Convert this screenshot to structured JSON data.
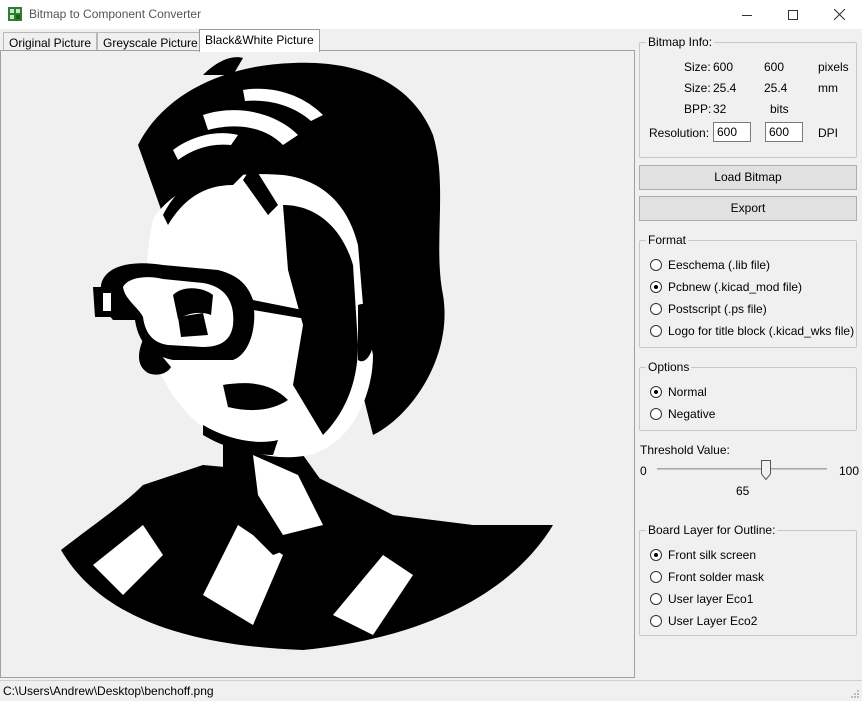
{
  "window": {
    "title": "Bitmap to Component Converter",
    "minimize_icon": "minimize-icon",
    "maximize_icon": "maximize-icon",
    "close_icon": "close-icon"
  },
  "tabs": [
    {
      "label": "Original Picture",
      "active": false
    },
    {
      "label": "Greyscale Picture",
      "active": false
    },
    {
      "label": "Black&White Picture",
      "active": true
    }
  ],
  "bitmap_info": {
    "title": "Bitmap Info:",
    "size_label": "Size:",
    "size_px_w": "600",
    "size_px_h": "600",
    "size_px_unit": "pixels",
    "size_mm_label": "Size:",
    "size_mm_w": "25.4",
    "size_mm_h": "25.4",
    "size_mm_unit": "mm",
    "bpp_label": "BPP:",
    "bpp_value": "32",
    "bpp_unit": "bits",
    "resolution_label": "Resolution:",
    "resolution_x": "600",
    "resolution_y": "600",
    "resolution_unit": "DPI"
  },
  "buttons": {
    "load": "Load Bitmap",
    "export": "Export"
  },
  "format": {
    "title": "Format",
    "options": [
      {
        "label": "Eeschema (.lib file)",
        "checked": false
      },
      {
        "label": "Pcbnew (.kicad_mod file)",
        "checked": true
      },
      {
        "label": "Postscript (.ps file)",
        "checked": false
      },
      {
        "label": "Logo for title block (.kicad_wks file)",
        "checked": false
      }
    ]
  },
  "options": {
    "title": "Options",
    "items": [
      {
        "label": "Normal",
        "checked": true
      },
      {
        "label": "Negative",
        "checked": false
      }
    ]
  },
  "threshold": {
    "label": "Threshold Value:",
    "min": "0",
    "max": "100",
    "value": "65"
  },
  "board_layer": {
    "title": "Board Layer for Outline:",
    "options": [
      {
        "label": "Front silk screen",
        "checked": true
      },
      {
        "label": "Front solder mask",
        "checked": false
      },
      {
        "label": "User layer Eco1",
        "checked": false
      },
      {
        "label": "User Layer Eco2",
        "checked": false
      }
    ]
  },
  "status": {
    "path": "C:\\Users\\Andrew\\Desktop\\benchoff.png"
  },
  "colors": {
    "image_ink": "#000000",
    "image_paper": "#ffffff",
    "panel_bg": "#f0f0f0"
  }
}
